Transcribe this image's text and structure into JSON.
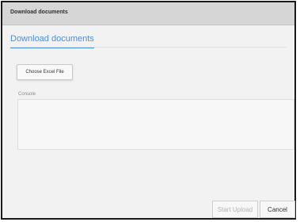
{
  "dialog": {
    "title": "Download documents"
  },
  "tabs": [
    {
      "label": "Download documents",
      "active": true
    }
  ],
  "upload": {
    "choose_label": "Choose Excel File"
  },
  "console": {
    "label": "Console",
    "content": ""
  },
  "footer": {
    "start_label": "Start Upload",
    "start_enabled": false,
    "cancel_label": "Cancel"
  },
  "colors": {
    "accent": "#4a8fd6",
    "titlebar": "#d6d6d6",
    "panel": "#f2f2f2"
  }
}
